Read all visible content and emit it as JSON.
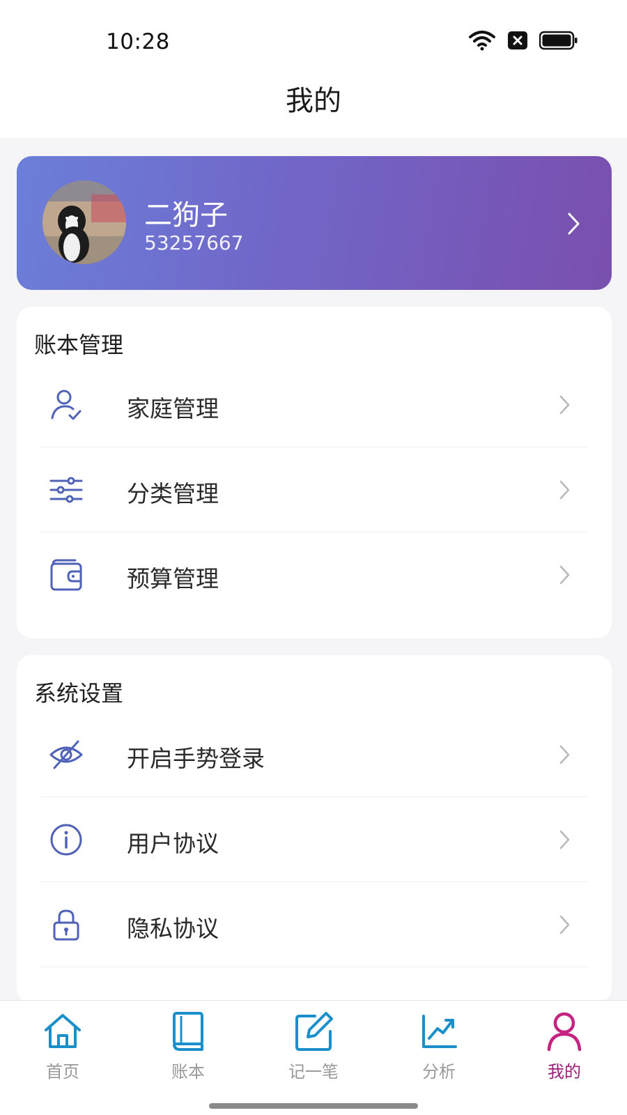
{
  "status_bar": {
    "time": "10:28",
    "icons": [
      "wifi-icon",
      "notification-x-icon",
      "battery-icon"
    ]
  },
  "header": {
    "title": "我的"
  },
  "profile": {
    "name": "二狗子",
    "id": "53257667",
    "avatar": "dog-avatar-photo",
    "gradient": [
      "#6b7fd9",
      "#7a4fae"
    ]
  },
  "sections": [
    {
      "title": "账本管理",
      "items": [
        {
          "label": "家庭管理",
          "icon": "user-check-icon"
        },
        {
          "label": "分类管理",
          "icon": "sliders-icon"
        },
        {
          "label": "预算管理",
          "icon": "wallet-icon"
        }
      ]
    },
    {
      "title": "系统设置",
      "items": [
        {
          "label": "开启手势登录",
          "icon": "eye-off-icon"
        },
        {
          "label": "用户协议",
          "icon": "info-icon"
        },
        {
          "label": "隐私协议",
          "icon": "lock-icon"
        }
      ]
    }
  ],
  "tabs": [
    {
      "label": "首页",
      "icon": "home-icon",
      "active": false
    },
    {
      "label": "账本",
      "icon": "book-icon",
      "active": false
    },
    {
      "label": "记一笔",
      "icon": "edit-icon",
      "active": false
    },
    {
      "label": "分析",
      "icon": "trend-icon",
      "active": false
    },
    {
      "label": "我的",
      "icon": "user-icon",
      "active": true
    }
  ],
  "colors": {
    "tab_icon": "#1a8fc9",
    "tab_active": "#c4237f",
    "menu_icon": "#4f62b8"
  }
}
